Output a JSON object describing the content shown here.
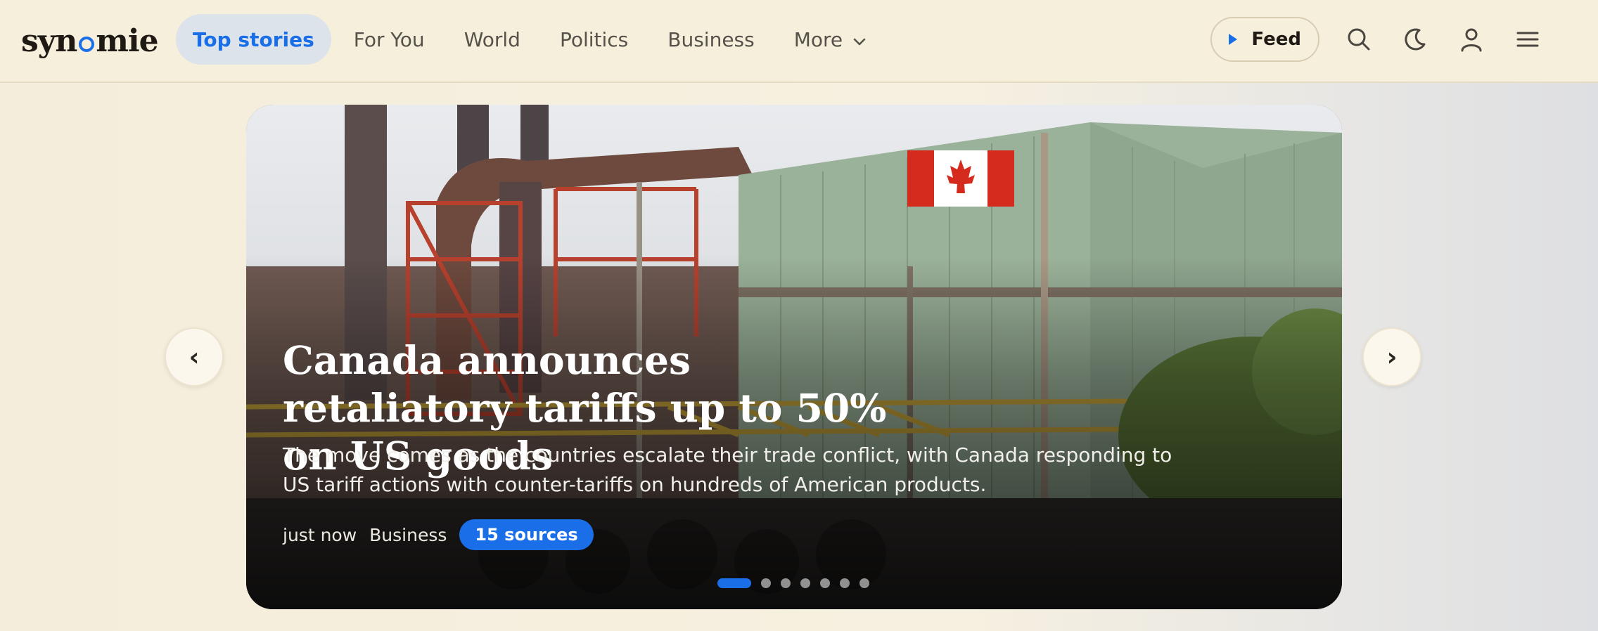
{
  "brand": {
    "logo_prefix": "syn",
    "logo_suffix": "mie"
  },
  "nav": {
    "items": [
      {
        "label": "Top stories",
        "active": true
      },
      {
        "label": "For You"
      },
      {
        "label": "World"
      },
      {
        "label": "Politics"
      },
      {
        "label": "Business"
      },
      {
        "label": "More"
      }
    ]
  },
  "toolbar": {
    "feed_label": "Feed",
    "icons": [
      "search-icon",
      "moon-icon",
      "user-icon",
      "menu-icon"
    ]
  },
  "hero": {
    "headline": "Canada announces retaliatory tariffs up to 50% on US goods",
    "dek": "The move comes as the countries escalate their trade conflict, with Canada responding to US tariff actions with counter-tariffs on hundreds of American products.",
    "time": "just now",
    "category": "Business",
    "sources": "15 sources",
    "slide_count": 7,
    "active_slide": 1
  },
  "carousel": {
    "prev": "‹",
    "next": "›"
  },
  "colors": {
    "accent": "#1a6fe8",
    "background": "#f6efdc"
  }
}
